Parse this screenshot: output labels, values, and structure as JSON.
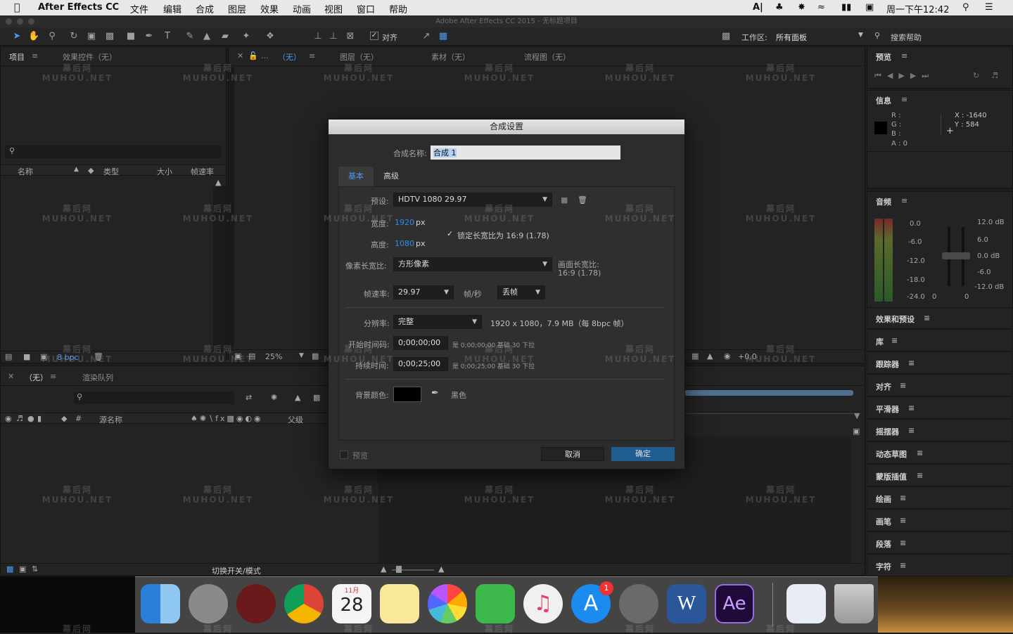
{
  "menubar": {
    "app": "After Effects CC",
    "items": [
      "文件",
      "编辑",
      "合成",
      "图层",
      "效果",
      "动画",
      "视图",
      "窗口",
      "帮助"
    ],
    "clock": "周一下午12:42"
  },
  "window_title": "Adobe After Effects CC 2015 - 无标题项目",
  "toolbar": {
    "align_label": "对齐",
    "workspace_label": "工作区:",
    "workspace_value": "所有面板",
    "search_help": "搜索帮助"
  },
  "project_panel": {
    "tab_project": "项目",
    "tab_effects": "效果控件（无）",
    "col_name": "名称",
    "col_type": "类型",
    "col_size": "大小",
    "col_fps": "帧速率",
    "bpc": "8 bpc"
  },
  "comp_panel": {
    "tab_comp": "（无）",
    "tab_layer": "图层（无）",
    "tab_footage": "素材（无）",
    "tab_flow": "流程图（无）",
    "zoom": "25%",
    "exposure": "+0.0"
  },
  "timeline_panel": {
    "tab_none": "（无）",
    "tab_render": "渲染队列",
    "col_source": "源名称",
    "col_parent": "父级",
    "toggle_label": "切换开关/模式"
  },
  "right_panels": {
    "preview": "预览",
    "info": "信息",
    "info_r": "R :",
    "info_g": "G :",
    "info_b": "B :",
    "info_a": "A : 0",
    "info_x": "X : -1640",
    "info_y": "Y : 584",
    "audio": "音频",
    "audio_left": [
      "0.0",
      "-6.0",
      "-12.0",
      "-18.0",
      "-24.0"
    ],
    "audio_right": [
      "12.0 dB",
      "6.0",
      "0.0 dB",
      "-6.0",
      "-12.0 dB"
    ],
    "audio_zero_l": "0",
    "audio_zero_r": "0",
    "list": [
      "效果和预设",
      "库",
      "跟踪器",
      "对齐",
      "平滑器",
      "摇摆器",
      "动态草图",
      "蒙版插值",
      "绘画",
      "画笔",
      "段落",
      "字符"
    ]
  },
  "dialog": {
    "title": "合成设置",
    "name_label": "合成名称:",
    "name_value": "合成 1",
    "tab_basic": "基本",
    "tab_advanced": "高级",
    "preset_label": "预设:",
    "preset_value": "HDTV 1080 29.97",
    "width_label": "宽度:",
    "width_value": "1920",
    "width_unit": "px",
    "height_label": "高度:",
    "height_value": "1080",
    "height_unit": "px",
    "lock_label": "锁定长宽比为 16:9 (1.78)",
    "par_label": "像素长宽比:",
    "par_value": "方形像素",
    "frame_ar_label": "画面长宽比:",
    "frame_ar_value": "16:9 (1.78)",
    "fps_label": "帧速率:",
    "fps_value": "29.97",
    "fps_unit": "帧/秒",
    "drop_value": "丢帧",
    "res_label": "分辨率:",
    "res_value": "完整",
    "res_info": "1920 x 1080，7.9 MB（每 8bpc 帧）",
    "start_label": "开始时间码:",
    "start_value": "0;00;00;00",
    "start_info": "是 0;00;00;00  基础 30  下拉",
    "dur_label": "持续时间:",
    "dur_value": "0;00;25;00",
    "dur_info": "是 0;00;25;00  基础 30  下拉",
    "bg_label": "背景颜色:",
    "bg_name": "黑色",
    "bg_color": "#000000",
    "preview_label": "预览",
    "cancel": "取消",
    "ok": "确定"
  },
  "dock": {
    "calendar_month": "11月",
    "calendar_day": "28",
    "appstore_badge": "1",
    "ae_label": "Ae"
  },
  "watermark": {
    "cn": "幕后网",
    "en": "MUHOU.NET"
  }
}
